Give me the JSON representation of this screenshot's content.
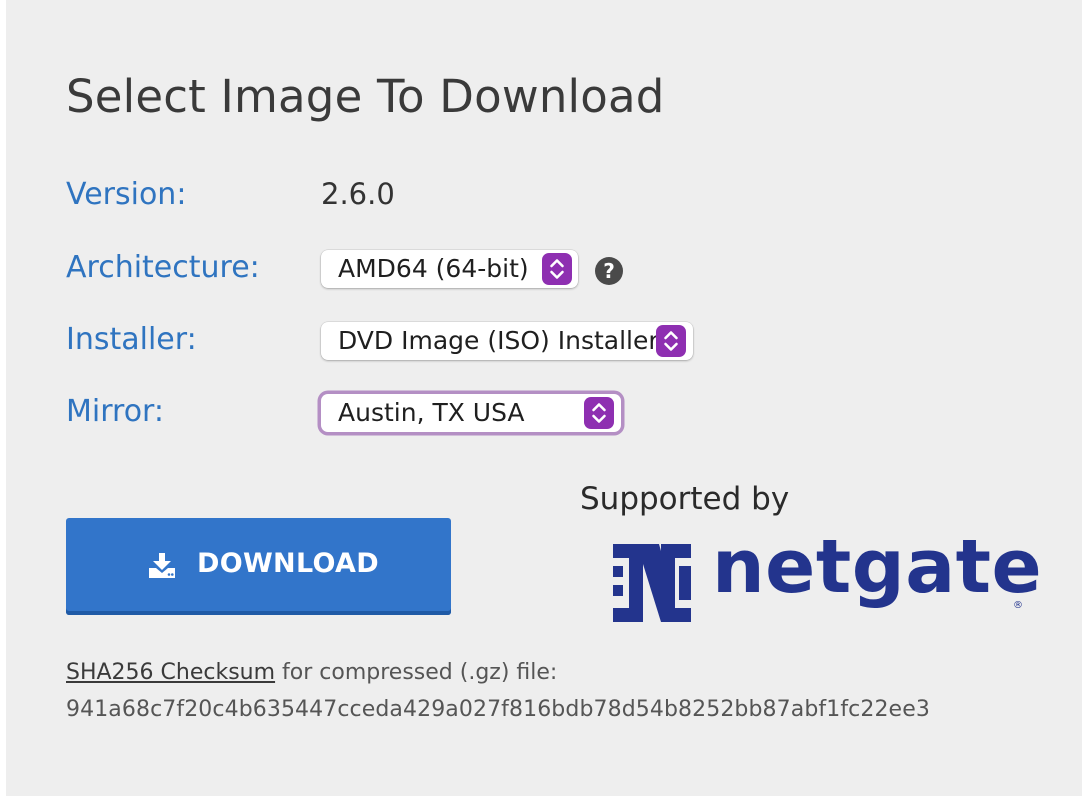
{
  "title": "Select Image To Download",
  "version": {
    "label": "Version:",
    "value": "2.6.0"
  },
  "architecture": {
    "label": "Architecture:",
    "selected": "AMD64 (64-bit)",
    "help_glyph": "?"
  },
  "installer": {
    "label": "Installer:",
    "selected": "DVD Image (ISO) Installer"
  },
  "mirror": {
    "label": "Mirror:",
    "selected": "Austin, TX USA"
  },
  "download_button": {
    "label": "DOWNLOAD",
    "icon": "download-icon",
    "color": "#3275ca"
  },
  "sponsor": {
    "supported_by": "Supported by",
    "logo_text": "netgate",
    "registered_mark": "®",
    "logo_color": "#23348d"
  },
  "checksum": {
    "link_label": "SHA256 Checksum",
    "description": " for compressed (.gz) file:",
    "hash": "941a68c7f20c4b635447cceda429a027f816bdb78d54b8252bb87abf1fc22ee3"
  },
  "colors": {
    "label_blue": "#2f74c0",
    "stepper_purple": "#8e2fb1",
    "focus_ring": "#b48fc4",
    "panel_bg": "#eeeeee"
  }
}
